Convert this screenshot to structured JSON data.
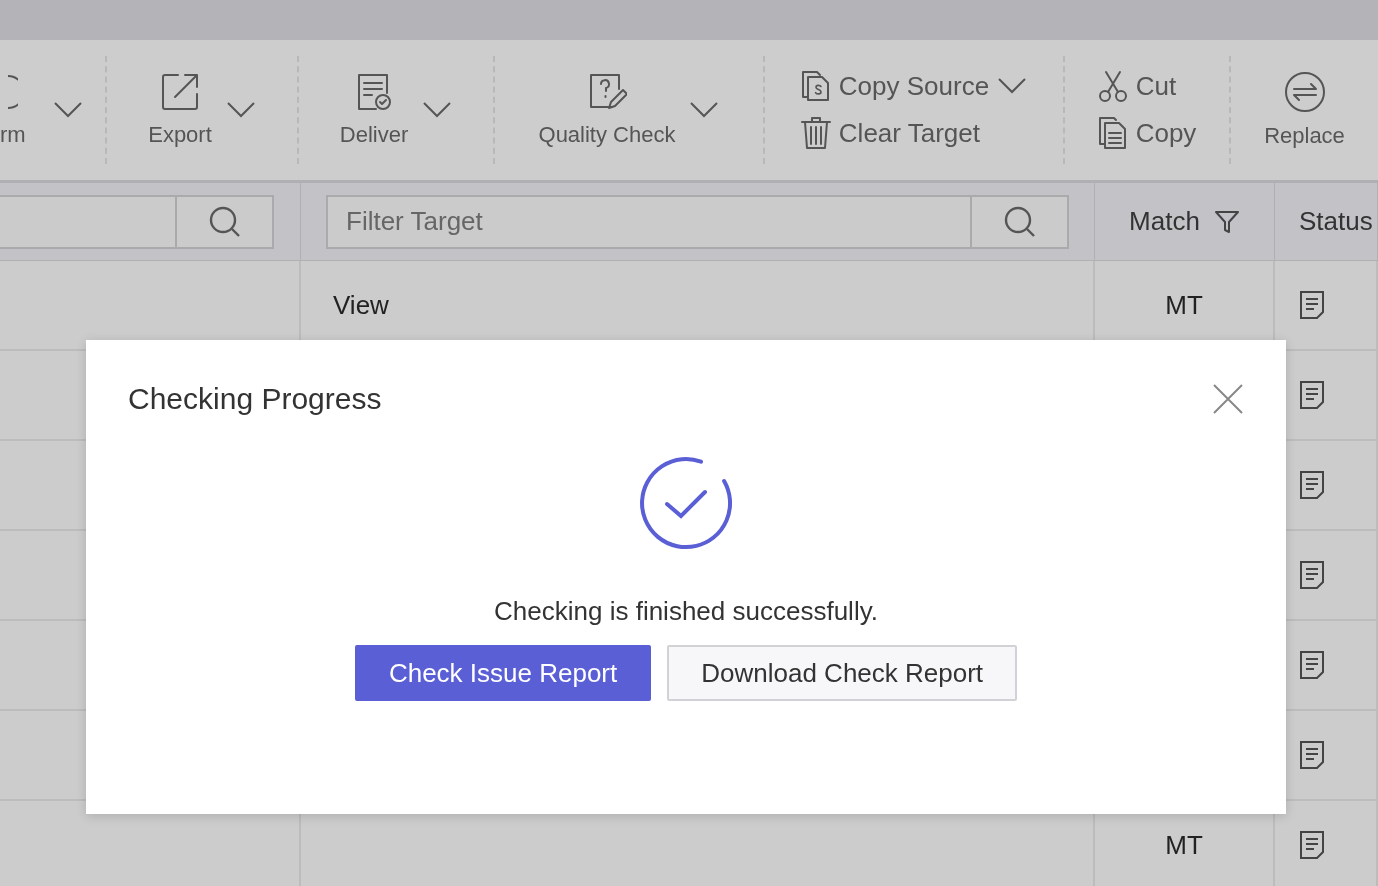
{
  "toolbar": [
    {
      "kind": "large",
      "label": "rm",
      "dropdown": true
    },
    {
      "kind": "large",
      "label": "Export",
      "dropdown": true
    },
    {
      "kind": "large",
      "label": "Deliver",
      "dropdown": true
    },
    {
      "kind": "large",
      "label": "Quality Check",
      "dropdown": true
    },
    {
      "kind": "stacked",
      "items": [
        {
          "label": "Copy Source",
          "dropdown": true
        },
        {
          "label": "Clear Target",
          "dropdown": false
        }
      ]
    },
    {
      "kind": "stacked",
      "items": [
        {
          "label": "Cut",
          "dropdown": false
        },
        {
          "label": "Copy",
          "dropdown": false
        }
      ]
    },
    {
      "kind": "large",
      "label": "Replace",
      "dropdown": false
    }
  ],
  "filters": {
    "target": {
      "placeholder": "Filter Target"
    }
  },
  "columns": {
    "match": "Match",
    "status": "Status"
  },
  "rows": [
    {
      "target": "View",
      "match": "MT"
    },
    {},
    {},
    {},
    {},
    {},
    {
      "match": "MT"
    }
  ],
  "dialog": {
    "title": "Checking Progress",
    "message": "Checking is finished successfully.",
    "buttons": [
      {
        "label": "Check Issue Report",
        "kind": "primary"
      },
      {
        "label": "Download Check Report",
        "kind": "secondary"
      }
    ]
  }
}
